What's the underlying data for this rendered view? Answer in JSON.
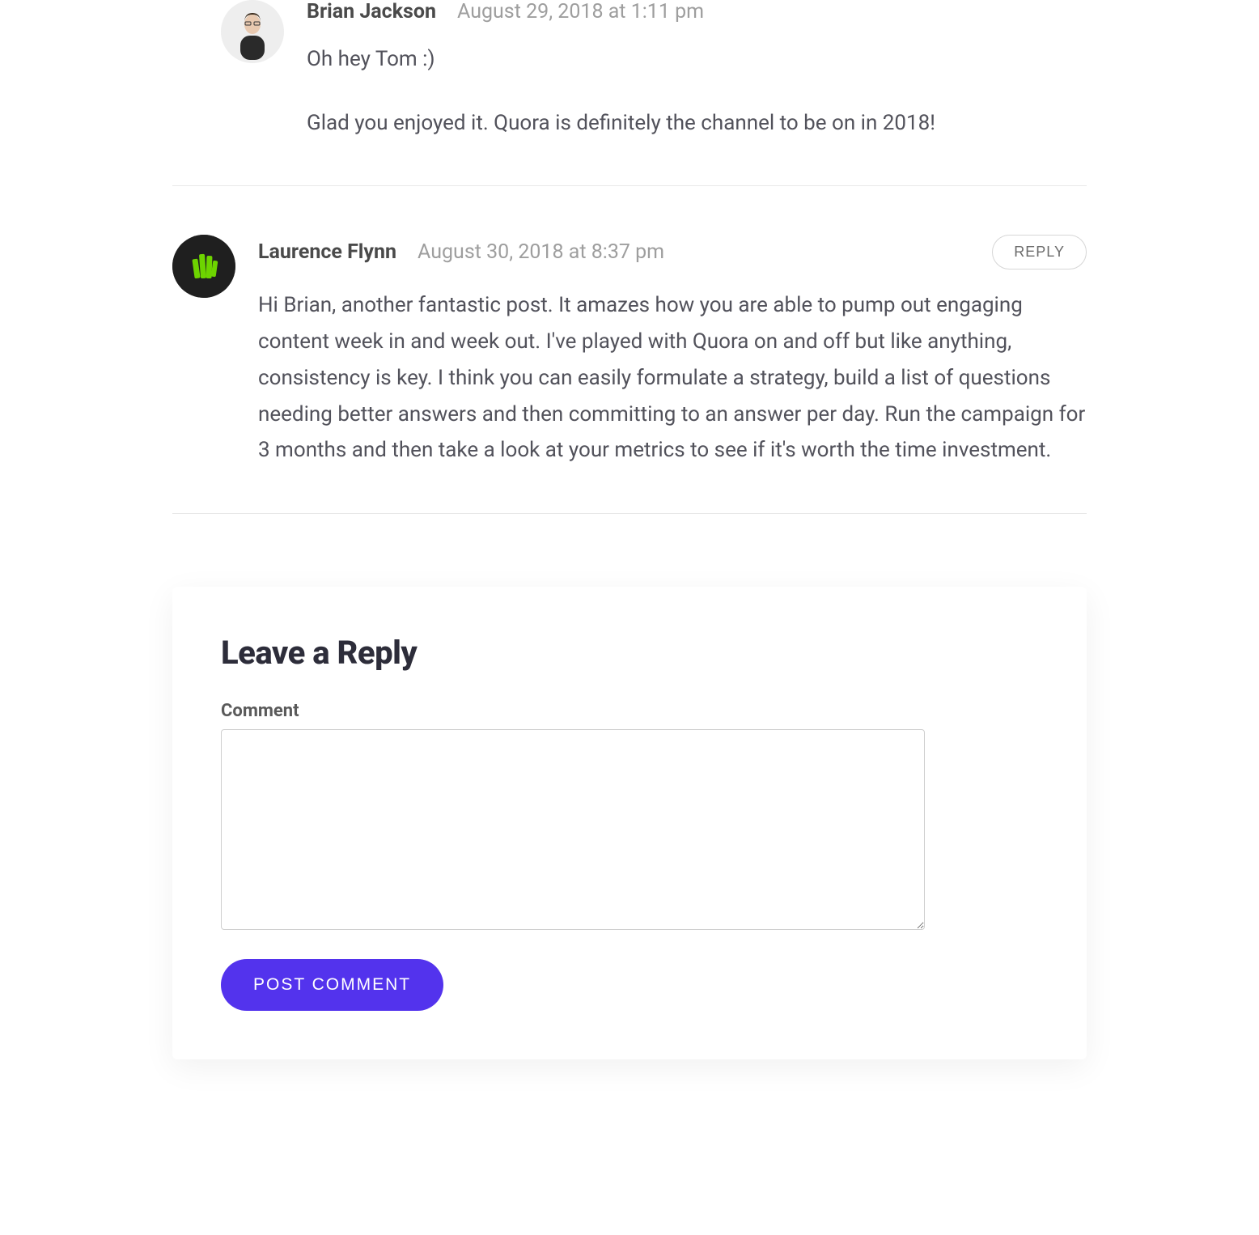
{
  "comments": [
    {
      "author": "Brian Jackson",
      "date": "August 29, 2018 at 1:11 pm",
      "paragraphs": [
        "Oh hey Tom :)",
        "Glad you enjoyed it. Quora is definitely the channel to be on in 2018!"
      ]
    },
    {
      "author": "Laurence Flynn",
      "date": "August 30, 2018 at 8:37 pm",
      "reply_label": "REPLY",
      "paragraphs": [
        "Hi Brian, another fantastic post. It amazes how you are able to pump out engaging content week in and week out. I've played with Quora on and off but like anything, consistency is key. I think you can easily formulate a strategy, build a list of questions needing better answers and then committing to an answer per day. Run the campaign for 3 months and then take a look at your metrics to see if it's worth the time investment."
      ]
    }
  ],
  "form": {
    "title": "Leave a Reply",
    "comment_label": "Comment",
    "submit_label": "POST COMMENT"
  }
}
